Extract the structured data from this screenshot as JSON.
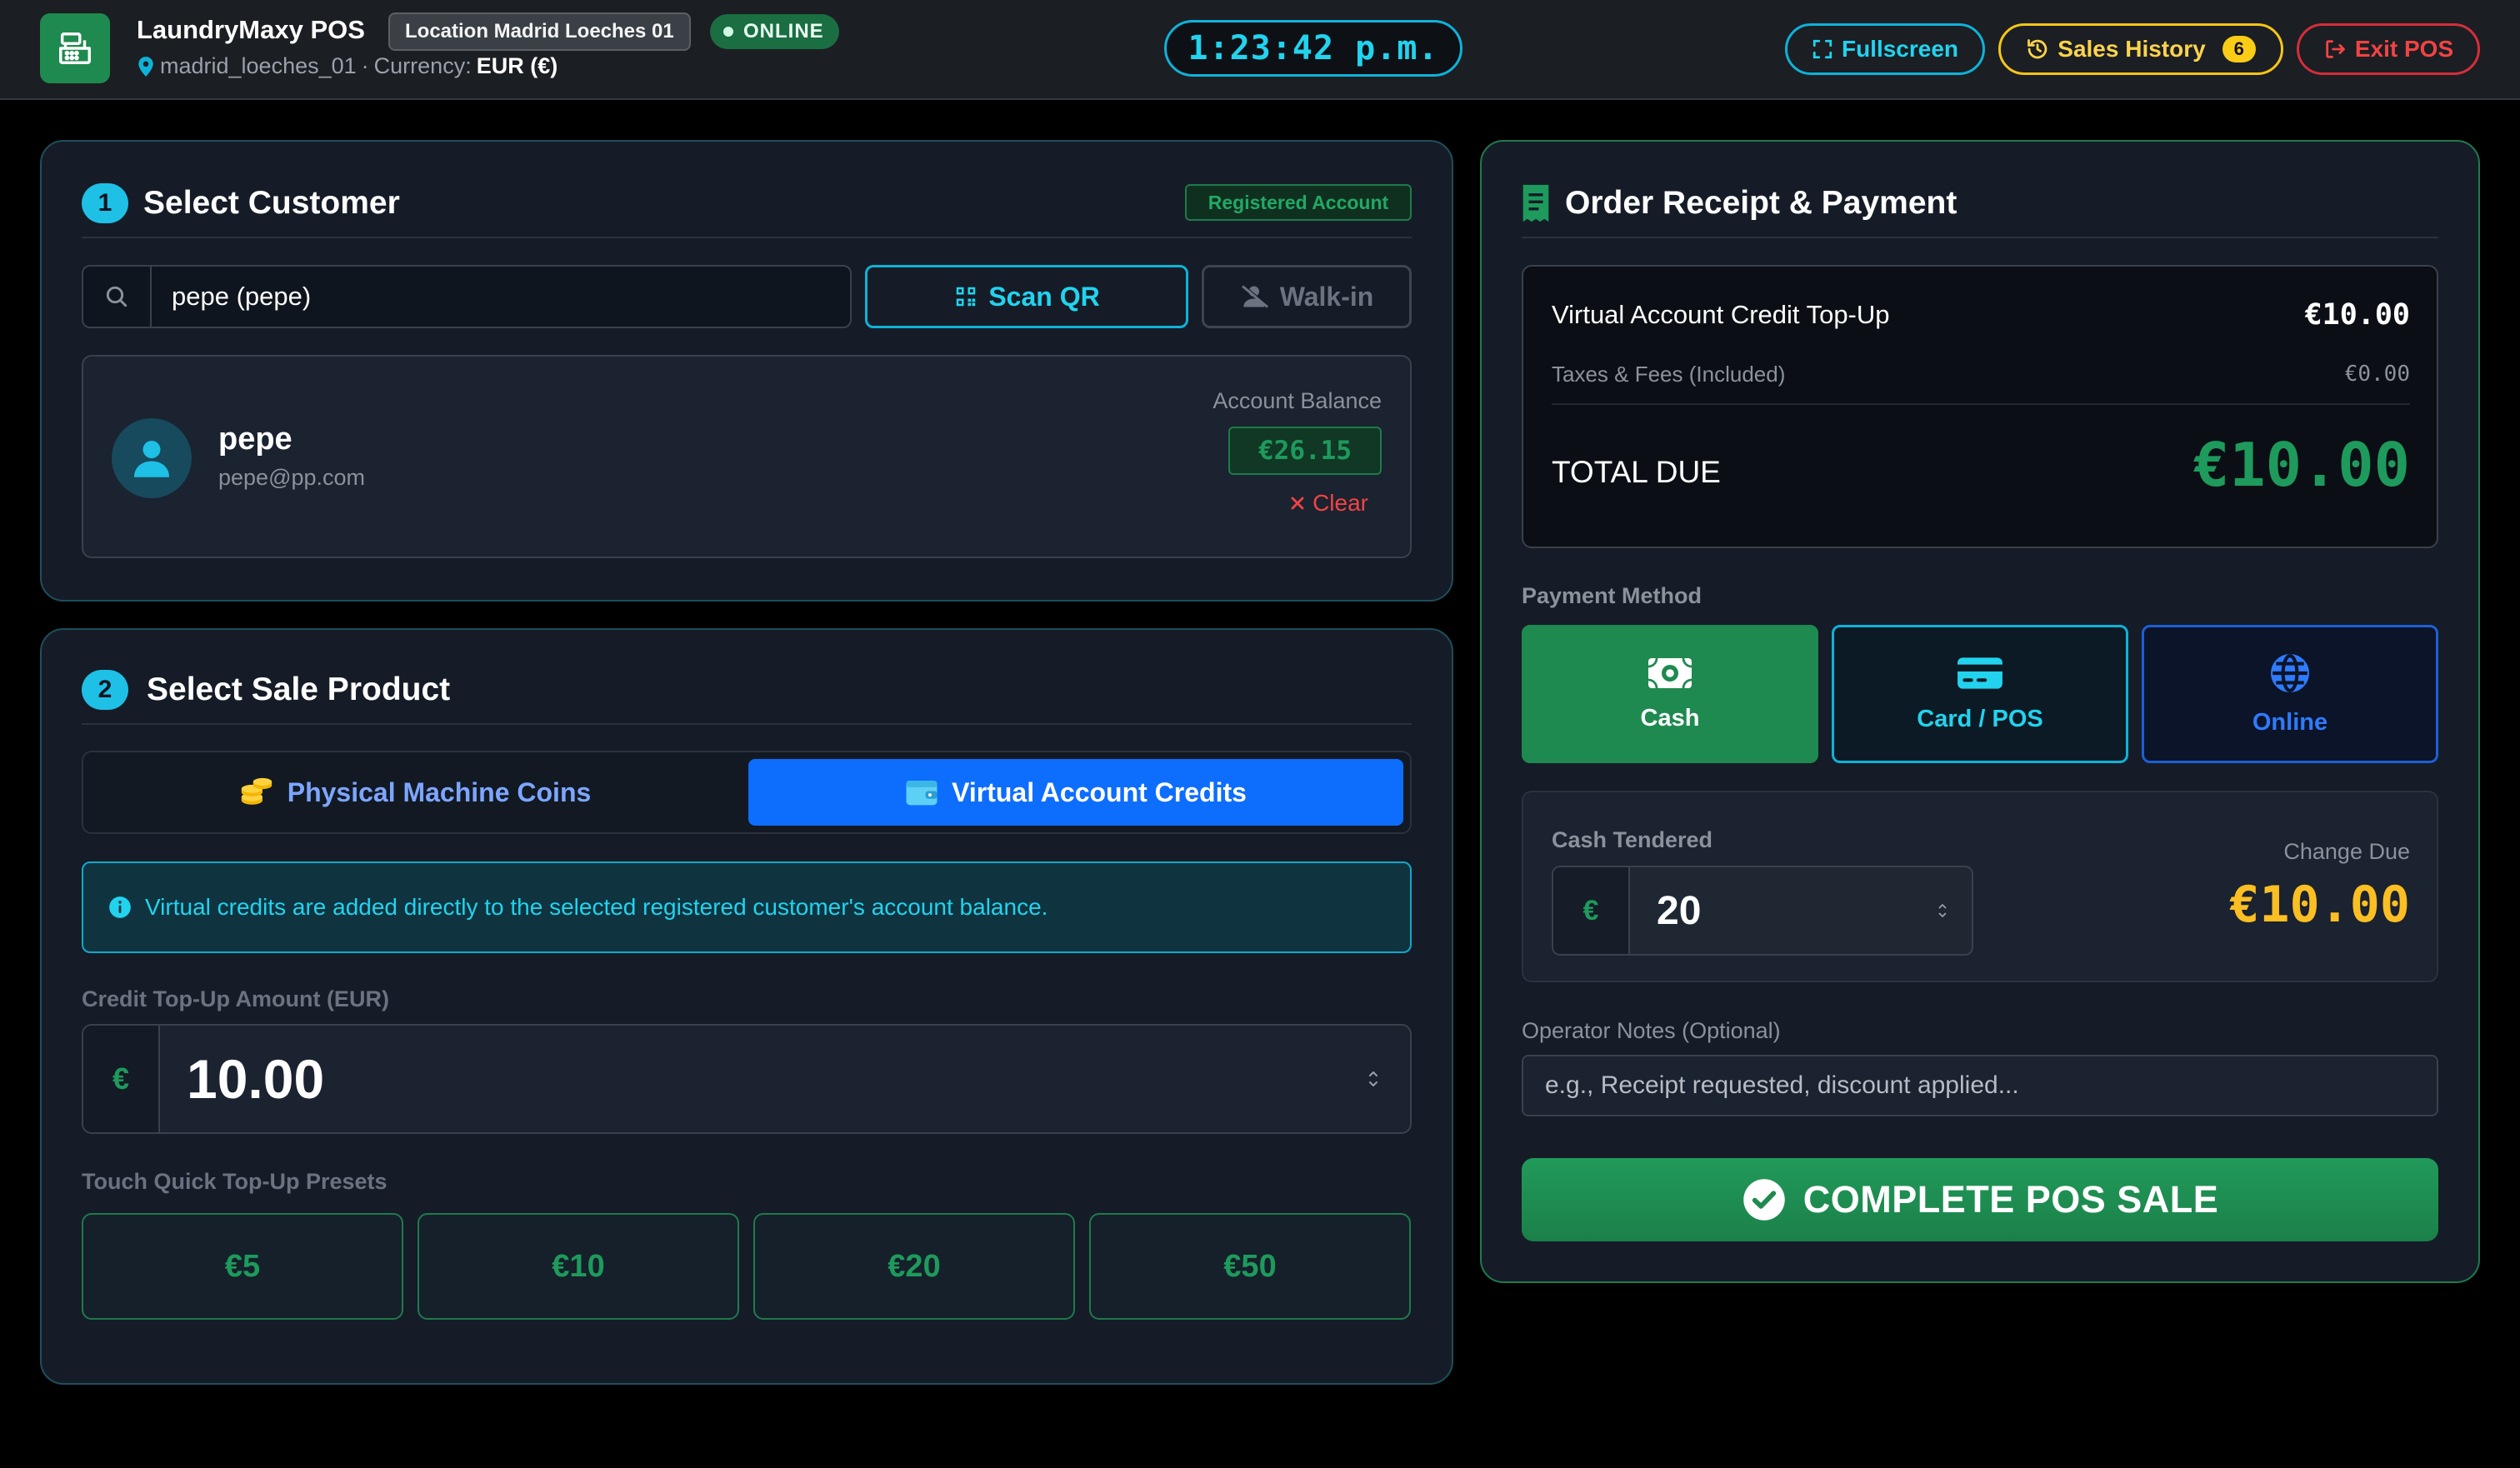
{
  "app": {
    "title": "LaundryMaxy POS",
    "location_badge": "Location Madrid Loeches 01",
    "status": "ONLINE",
    "location_id": "madrid_loeches_01",
    "currency_sep": "·",
    "currency_label": "Currency:",
    "currency_value": "EUR (€)",
    "clock": "1:23:42 p.m."
  },
  "toolbar": {
    "fullscreen_label": "Fullscreen",
    "history_label": "Sales History",
    "history_count": "6",
    "exit_label": "Exit POS"
  },
  "customer": {
    "step": "1",
    "title": "Select Customer",
    "badge": "Registered Account",
    "search_value": "pepe (pepe)",
    "scan_label": "Scan QR",
    "walkin_label": "Walk-in",
    "name": "pepe",
    "email": "pepe@pp.com",
    "balance_label": "Account Balance",
    "balance_value": "€26.15",
    "clear_label": "Clear"
  },
  "product": {
    "step": "2",
    "title": "Select Sale Product",
    "tabs": [
      {
        "label": "Physical Machine Coins",
        "active": false
      },
      {
        "label": "Virtual Account Credits",
        "active": true
      }
    ],
    "info_text": "Virtual credits are added directly to the selected registered customer's account balance.",
    "amount_label": "Credit Top-Up Amount (EUR)",
    "currency_symbol": "€",
    "amount_value": "10.00",
    "presets_label": "Touch Quick Top-Up Presets",
    "presets": [
      "€5",
      "€10",
      "€20",
      "€50"
    ]
  },
  "receipt": {
    "title": "Order Receipt & Payment",
    "item_label": "Virtual Account Credit Top-Up",
    "item_value": "€10.00",
    "tax_label": "Taxes & Fees (Included)",
    "tax_value": "€0.00",
    "total_label": "TOTAL DUE",
    "total_value": "€10.00"
  },
  "payment": {
    "method_label": "Payment Method",
    "methods": [
      {
        "label": "Cash",
        "icon": "cash-icon",
        "selected": true
      },
      {
        "label": "Card / POS",
        "icon": "card-icon",
        "selected": false
      },
      {
        "label": "Online",
        "icon": "globe-icon",
        "selected": false
      }
    ],
    "tendered_label": "Cash Tendered",
    "currency_symbol": "€",
    "tendered_value": "20",
    "change_label": "Change Due",
    "change_value": "€10.00",
    "notes_label": "Operator Notes (Optional)",
    "notes_placeholder": "e.g., Receipt requested, discount applied...",
    "complete_label": "COMPLETE POS SALE"
  },
  "colors": {
    "accent_green": "#1e9a5c",
    "accent_cyan": "#22d3ee",
    "accent_blue": "#0d6efd",
    "accent_yellow": "#fbbf24",
    "danger": "#ef4444"
  }
}
